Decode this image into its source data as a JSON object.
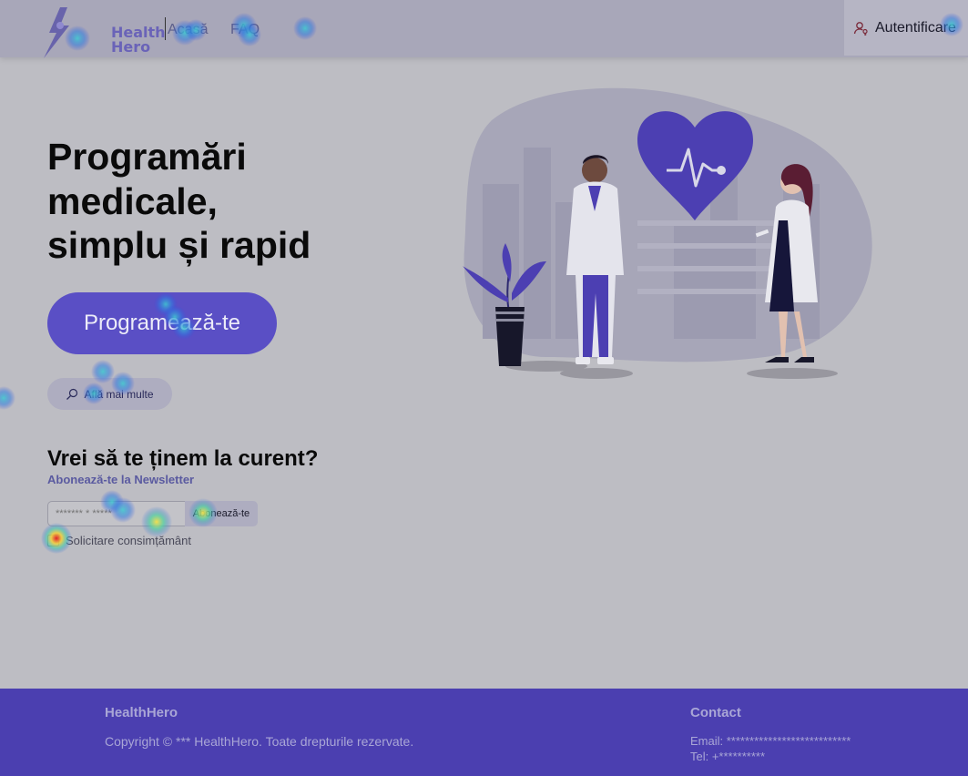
{
  "header": {
    "logo_line1": "Health",
    "logo_line2": "Hero",
    "nav": [
      {
        "label": "Acasă"
      },
      {
        "label": "FAQ"
      }
    ],
    "auth_label": "Autentificare"
  },
  "hero": {
    "title_line1": "Programări",
    "title_line2": "medicale,",
    "title_line3": "simplu și rapid",
    "primary_cta": "Programează-te",
    "secondary_cta": "Află mai multe"
  },
  "newsletter": {
    "title": "Vrei să te ținem la curent?",
    "subtitle": "Abonează-te la Newsletter",
    "input_placeholder": "******* * *****",
    "subscribe_label": "Abonează-te",
    "consent_label": "Solicitare consimțământ"
  },
  "footer": {
    "brand": "HealthHero",
    "copyright": "Copyright © *** HealthHero. Toate drepturile rezervate.",
    "contact_title": "Contact",
    "email": "Email: ***************************",
    "tel": "Tel: +**********"
  },
  "colors": {
    "brand": "#5a4fc5",
    "footer_bg": "#4b3fb0",
    "page_bg": "#bdbdc3"
  },
  "icons": {
    "auth": "user-key-icon",
    "learn_more": "search-icon",
    "logo": "logo-icon"
  }
}
